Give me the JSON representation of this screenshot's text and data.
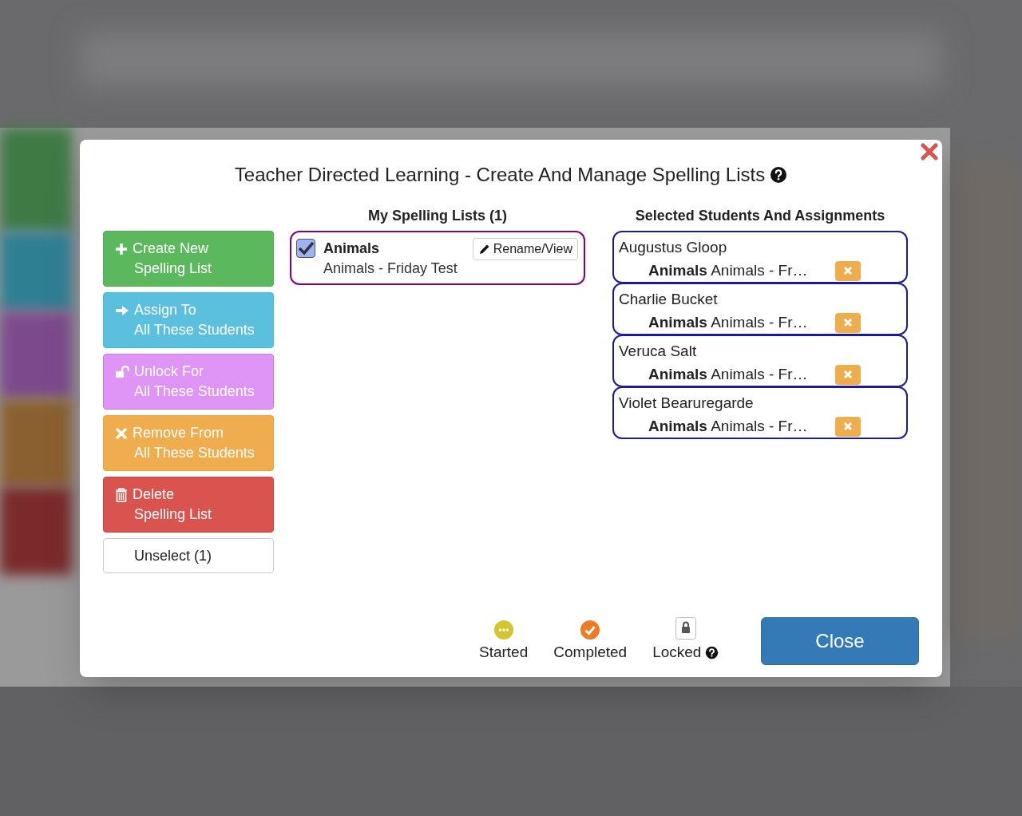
{
  "dialog": {
    "title": "Teacher Directed Learning - Create And Manage Spelling Lists",
    "close_button": "Close"
  },
  "actions": [
    {
      "kind": "create",
      "line1": "Create New",
      "line2": "Spelling List"
    },
    {
      "kind": "assign",
      "line1": "Assign To",
      "line2": "All These Students"
    },
    {
      "kind": "unlock",
      "line1": "Unlock For",
      "line2": "All These Students"
    },
    {
      "kind": "remove",
      "line1": "Remove From",
      "line2": "All These Students"
    },
    {
      "kind": "delete",
      "line1": "Delete",
      "line2": "Spelling List"
    }
  ],
  "unselect_button": "Unselect (1)",
  "spelling_lists": {
    "heading": "My Spelling Lists (1)",
    "items": [
      {
        "name": "Animals",
        "description": "Animals - Friday Test",
        "checked": true,
        "rename_button": "Rename/View"
      }
    ]
  },
  "students": {
    "heading": "Selected Students And Assignments",
    "items": [
      {
        "name": "Augustus Gloop",
        "assignment": "**Animals** Animals - Fr…"
      },
      {
        "name": "Charlie Bucket",
        "assignment": "**Animals** Animals - Fr…"
      },
      {
        "name": "Veruca Salt",
        "assignment": "**Animals** Animals - Fr…"
      },
      {
        "name": "Violet Bearuregarde",
        "assignment": "**Animals** Animals - Fr…"
      }
    ]
  },
  "legend": [
    {
      "kind": "started",
      "label": "Started"
    },
    {
      "kind": "completed",
      "label": "Completed"
    },
    {
      "kind": "locked",
      "label": "Locked"
    }
  ]
}
